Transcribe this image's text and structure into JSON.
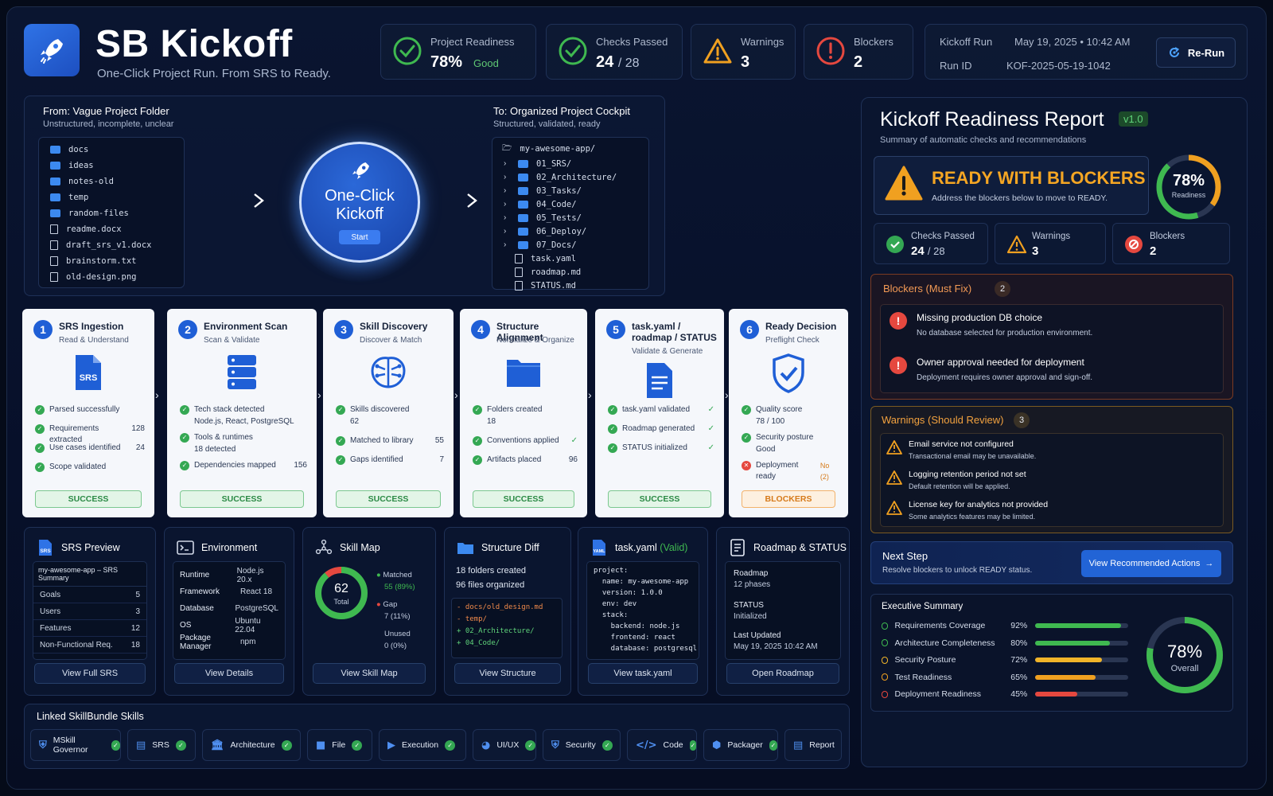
{
  "header": {
    "title": "SB Kickoff",
    "subtitle": "One-Click Project Run. From SRS to Ready.",
    "readiness_label": "Project Readiness",
    "readiness_value": "78%",
    "readiness_status": "Good",
    "checks_label": "Checks Passed",
    "checks_value": "24",
    "checks_total": "/ 28",
    "warnings_label": "Warnings",
    "warnings_value": "3",
    "blockers_label": "Blockers",
    "blockers_value": "2",
    "run_label": "Kickoff Run",
    "run_date": "May 19, 2025  •  10:42 AM",
    "runid_label": "Run ID",
    "runid_value": "KOF-2025-05-19-1042",
    "rerun_label": "Re-Run"
  },
  "transform": {
    "from_title": "From: Vague Project Folder",
    "from_sub": "Unstructured, incomplete, unclear",
    "from_items": [
      {
        "name": "docs",
        "icon": "folder"
      },
      {
        "name": "ideas",
        "icon": "folder"
      },
      {
        "name": "notes-old",
        "icon": "folder"
      },
      {
        "name": "temp",
        "icon": "folder"
      },
      {
        "name": "random-files",
        "icon": "folder"
      },
      {
        "name": "readme.docx",
        "icon": "file"
      },
      {
        "name": "draft_srs_v1.docx",
        "icon": "file"
      },
      {
        "name": "brainstorm.txt",
        "icon": "file"
      },
      {
        "name": "old-design.png",
        "icon": "image"
      }
    ],
    "kickoff_line1": "One-Click",
    "kickoff_line2": "Kickoff",
    "start_label": "Start",
    "to_title": "To: Organized Project Cockpit",
    "to_sub": "Structured, validated, ready",
    "to_root": "my-awesome-app/",
    "to_items": [
      {
        "name": "01_SRS/",
        "icon": "folder"
      },
      {
        "name": "02_Architecture/",
        "icon": "folder"
      },
      {
        "name": "03_Tasks/",
        "icon": "folder"
      },
      {
        "name": "04_Code/",
        "icon": "folder"
      },
      {
        "name": "05_Tests/",
        "icon": "folder"
      },
      {
        "name": "06_Deploy/",
        "icon": "folder"
      },
      {
        "name": "07_Docs/",
        "icon": "folder"
      },
      {
        "name": "task.yaml",
        "icon": "file"
      },
      {
        "name": "roadmap.md",
        "icon": "file"
      },
      {
        "name": "STATUS.md",
        "icon": "file"
      }
    ]
  },
  "steps": [
    {
      "num": "1",
      "title": "SRS Ingestion",
      "sub": "Read & Understand",
      "badge": "SUCCESS",
      "checks": [
        {
          "t": "Parsed successfully",
          "v": ""
        },
        {
          "t": "Requirements extracted",
          "v": "128"
        },
        {
          "t": "Use cases identified",
          "v": "24"
        },
        {
          "t": "Scope validated",
          "v": ""
        }
      ]
    },
    {
      "num": "2",
      "title": "Environment Scan",
      "sub": "Scan & Validate",
      "badge": "SUCCESS",
      "checks": [
        {
          "t": "Tech stack detected",
          "v": ""
        },
        {
          "t": "Node.js, React, PostgreSQL",
          "v": ""
        },
        {
          "t": "Tools & runtimes",
          "v": ""
        },
        {
          "t": "18 detected",
          "v": ""
        },
        {
          "t": "Dependencies mapped",
          "v": "156"
        }
      ]
    },
    {
      "num": "3",
      "title": "Skill Discovery",
      "sub": "Discover & Match",
      "badge": "SUCCESS",
      "checks": [
        {
          "t": "Skills discovered",
          "v": ""
        },
        {
          "t": "62",
          "v": ""
        },
        {
          "t": "Matched to library",
          "v": "55"
        },
        {
          "t": "Gaps identified",
          "v": "7"
        }
      ]
    },
    {
      "num": "4",
      "title": "Structure Alignment",
      "sub": "Normalize & Organize",
      "badge": "SUCCESS",
      "checks": [
        {
          "t": "Folders created",
          "v": ""
        },
        {
          "t": "18",
          "v": ""
        },
        {
          "t": "Conventions applied",
          "v": "✓"
        },
        {
          "t": "Artifacts placed",
          "v": "96"
        }
      ]
    },
    {
      "num": "5",
      "title": "task.yaml /",
      "title2": "roadmap / STATUS",
      "sub": "Validate & Generate",
      "badge": "SUCCESS",
      "checks": [
        {
          "t": "task.yaml validated",
          "v": "✓"
        },
        {
          "t": "Roadmap generated",
          "v": "✓"
        },
        {
          "t": "STATUS initialized",
          "v": "✓"
        }
      ]
    },
    {
      "num": "6",
      "title": "Ready Decision",
      "sub": "Preflight Check",
      "badge": "BLOCKERS",
      "checks": [
        {
          "t": "Quality score",
          "v": ""
        },
        {
          "t": "78 / 100",
          "v": ""
        },
        {
          "t": "Security posture",
          "v": ""
        },
        {
          "t": "Good",
          "v": ""
        },
        {
          "t": "Deployment ready",
          "v": "No (2)"
        }
      ]
    }
  ],
  "cards": {
    "srs": {
      "title": "SRS Preview",
      "header": "my-awesome-app – SRS Summary",
      "rows": [
        {
          "k": "Goals",
          "v": "5"
        },
        {
          "k": "Users",
          "v": "3"
        },
        {
          "k": "Features",
          "v": "12"
        },
        {
          "k": "Non-Functional Req.",
          "v": "18"
        }
      ],
      "button": "View Full SRS"
    },
    "env": {
      "title": "Environment",
      "rows": [
        {
          "k": "Runtime",
          "v": "Node.js 20.x"
        },
        {
          "k": "Framework",
          "v": "React 18"
        },
        {
          "k": "Database",
          "v": "PostgreSQL"
        },
        {
          "k": "OS",
          "v": "Ubuntu 22.04"
        },
        {
          "k": "Package Manager",
          "v": "npm"
        }
      ],
      "button": "View Details"
    },
    "skillmap": {
      "title": "Skill Map",
      "total": "62",
      "total_label": "Total",
      "matched_label": "Matched",
      "matched_value": "55 (89%)",
      "gap_label": "Gap",
      "gap_value": "7 (11%)",
      "unused_label": "Unused",
      "unused_value": "0  (0%)",
      "matched_pct": 0.89,
      "button": "View Skill Map"
    },
    "diff": {
      "title": "Structure Diff",
      "line1": "18 folders created",
      "line2": "96 files organized",
      "removed": [
        "- docs/old_design.md",
        "- temp/"
      ],
      "added": [
        "+ 02_Architecture/",
        "+ 04_Code/"
      ],
      "button": "View Structure"
    },
    "yaml": {
      "title": "task.yaml",
      "valid": "(Valid)",
      "lines": [
        "project:",
        "  name: my-awesome-app",
        "  version: 1.0.0",
        "  env: dev",
        "  stack:",
        "    backend: node.js",
        "    frontend: react",
        "    database: postgresql"
      ],
      "button": "View task.yaml"
    },
    "roadmap": {
      "title": "Roadmap & STATUS",
      "roadmap_label": "Roadmap",
      "roadmap_value": "12 phases",
      "status_label": "STATUS",
      "status_value": "Initialized",
      "updated_label": "Last Updated",
      "updated_value": "May 19, 2025 10:42 AM",
      "button": "Open Roadmap"
    }
  },
  "skills": {
    "title": "Linked SkillBundle Skills",
    "items": [
      "MSkill Governor",
      "SRS",
      "Architecture",
      "File",
      "Execution",
      "UI/UX",
      "Security",
      "Code",
      "Packager",
      "Report"
    ]
  },
  "report": {
    "title": "Kickoff Readiness Report",
    "version": "v1.0",
    "subtitle": "Summary of automatic checks and recommendations",
    "status": "READY WITH BLOCKERS",
    "status_sub": "Address the blockers below to move to READY.",
    "gauge_value": "78%",
    "gauge_label": "Readiness",
    "gauge_pct": 0.78,
    "checks_label": "Checks Passed",
    "checks_value": "24",
    "checks_total": "/ 28",
    "warnings_label": "Warnings",
    "warnings_value": "3",
    "blockers_label": "Blockers",
    "blockers_value": "2",
    "blockers_title": "Blockers (Must Fix)",
    "blockers_count": "2",
    "blockers": [
      {
        "t": "Missing production DB choice",
        "d": "No database selected for production environment."
      },
      {
        "t": "Owner approval needed for deployment",
        "d": "Deployment requires owner approval and sign-off."
      }
    ],
    "warnings_title": "Warnings (Should Review)",
    "warnings_count": "3",
    "warnings": [
      {
        "t": "Email service not configured",
        "d": "Transactional email may be unavailable."
      },
      {
        "t": "Logging retention period not set",
        "d": "Default retention will be applied."
      },
      {
        "t": "License key for analytics not provided",
        "d": "Some analytics features may be limited."
      }
    ],
    "next_title": "Next Step",
    "next_sub": "Resolve blockers to unlock READY status.",
    "next_button": "View Recommended Actions",
    "exec_title": "Executive Summary",
    "exec": [
      {
        "t": "Requirements Coverage",
        "p": "92%",
        "v": 0.92,
        "c": "#3fb950"
      },
      {
        "t": "Architecture Completeness",
        "p": "80%",
        "v": 0.8,
        "c": "#3fb950"
      },
      {
        "t": "Security Posture",
        "p": "72%",
        "v": 0.72,
        "c": "#f0b429"
      },
      {
        "t": "Test Readiness",
        "p": "65%",
        "v": 0.65,
        "c": "#f0a020"
      },
      {
        "t": "Deployment Readiness",
        "p": "45%",
        "v": 0.45,
        "c": "#e5483f"
      }
    ],
    "overall_value": "78%",
    "overall_label": "Overall",
    "overall_pct": 0.78
  },
  "colors": {
    "accent": "#2f73e6",
    "success": "#34a853",
    "warning": "#f0a020",
    "danger": "#e5483f"
  }
}
